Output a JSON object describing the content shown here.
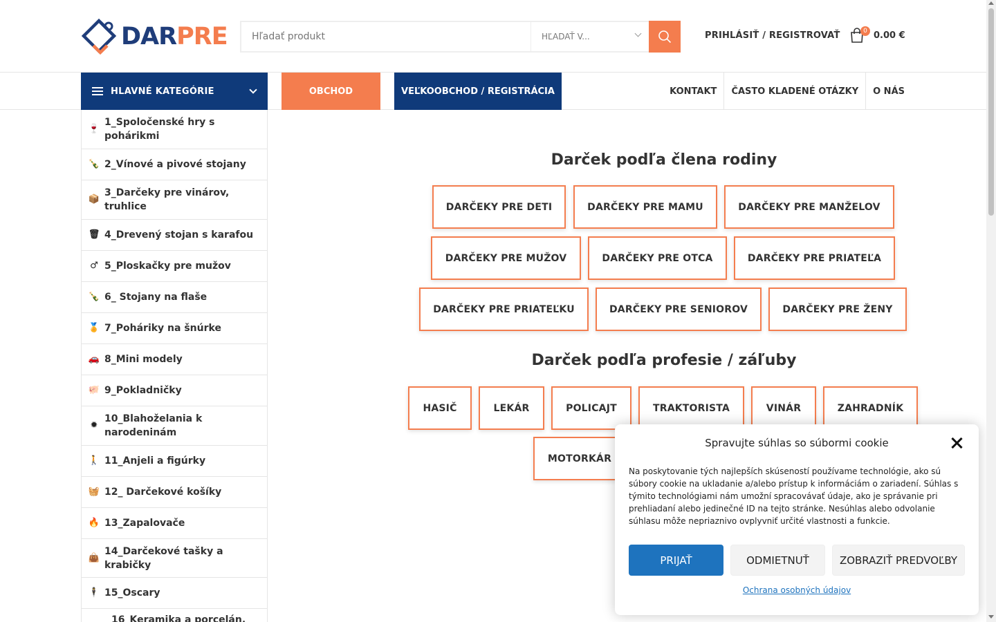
{
  "header": {
    "logo": {
      "part1": "DAR",
      "part2": "PRE"
    },
    "search": {
      "placeholder": "Hľadať produkt",
      "category_label": "HĽADAŤ V..."
    },
    "login_label": "PRIHLÁSIŤ / REGISTROVAŤ",
    "cart": {
      "count": "0",
      "total": "0.00 €"
    }
  },
  "nav": {
    "categories_label": "HLAVNÉ KATEGÓRIE",
    "shop_label": "OBCHOD",
    "wholesale_label": "VEĽKOOBCHOD / REGISTRÁCIA",
    "right_links": [
      "KONTAKT",
      "ČASTO KLADENÉ OTÁZKY",
      "O NÁS"
    ]
  },
  "sidebar": {
    "items": [
      {
        "label": "1_Spoločenské hry s pohárikmi",
        "icon": "wine-glass-icon",
        "glyph": "🍷"
      },
      {
        "label": "2_Vínové a pivové stojany",
        "icon": "bottle-icon",
        "glyph": "🍾"
      },
      {
        "label": "3_Darčeky pre vinárov, truhlice",
        "icon": "box-icon",
        "glyph": "📦"
      },
      {
        "label": "4_Drevený stojan s karafou",
        "icon": "tray-icon",
        "glyph": "🗑"
      },
      {
        "label": "5_Ploskačky pre mužov",
        "icon": "male-icon",
        "glyph": "♂"
      },
      {
        "label": "6_ Stojany na flaše",
        "icon": "bottle-icon",
        "glyph": "🍾"
      },
      {
        "label": "7_Poháriky na šnúrke",
        "icon": "medal-icon",
        "glyph": "🏅"
      },
      {
        "label": "8_Mini modely",
        "icon": "car-icon",
        "glyph": "🚗"
      },
      {
        "label": "9_Pokladničky",
        "icon": "piggy-bank-icon",
        "glyph": "🐖"
      },
      {
        "label": "10_Blahoželania k narodeninám",
        "icon": "certificate-icon",
        "glyph": "✹"
      },
      {
        "label": "11_Anjeli a figúrky",
        "icon": "walking-icon",
        "glyph": "🚶"
      },
      {
        "label": "12_ Darčekové košíky",
        "icon": "basket-icon",
        "glyph": "🧺"
      },
      {
        "label": "13_Zapalovače",
        "icon": "fire-icon",
        "glyph": "🔥"
      },
      {
        "label": "14_Darčekové tašky a krabičky",
        "icon": "bag-icon",
        "glyph": "👜"
      },
      {
        "label": "15_Oscary",
        "icon": "figure-icon",
        "glyph": "🕴"
      },
      {
        "label": "16_Keramika a porcelán,",
        "icon": "ceramic-icon",
        "glyph": ""
      }
    ]
  },
  "main": {
    "family_heading": "Darček podľa člena rodiny",
    "family_buttons": [
      "DARČEKY PRE DETI",
      "DARČEKY PRE MAMU",
      "DARČEKY PRE MANŽELOV",
      "DARČEKY PRE MUŽOV",
      "DARČEKY PRE OTCA",
      "DARČEKY PRE PRIATEĽA",
      "DARČEKY PRE PRIATEĽKU",
      "DARČEKY PRE SENIOROV",
      "DARČEKY PRE ŽENY"
    ],
    "profession_heading": "Darček podľa profesie / záľuby",
    "profession_buttons": [
      "HASIČ",
      "LEKÁR",
      "POLICAJT",
      "TRAKTORISTA",
      "VINÁR",
      "ZAHRADNÍK",
      "MOTORKÁR"
    ]
  },
  "cookie": {
    "title": "Spravujte súhlas so súbormi cookie",
    "text": "Na poskytovanie tých najlepších skúseností používame technológie, ako sú súbory cookie na ukladanie a/alebo prístup k informáciám o zariadení. Súhlas s týmito technológiami nám umožní spracovávať údaje, ako je správanie pri prehliadaní alebo jedinečné ID na tejto stránke. Nesúhlas alebo odvolanie súhlasu môže nepriaznivo ovplyvniť určité vlastnosti a funkcie.",
    "accept_label": "PRIJAŤ",
    "deny_label": "ODMIETNUŤ",
    "preferences_label": "ZOBRAZIŤ PREDVOĽBY",
    "privacy_link": "Ochrana osobných údajov"
  },
  "colors": {
    "brand_blue": "#0f3a7a",
    "brand_orange": "#f47d4e",
    "button_blue": "#1e73be"
  }
}
